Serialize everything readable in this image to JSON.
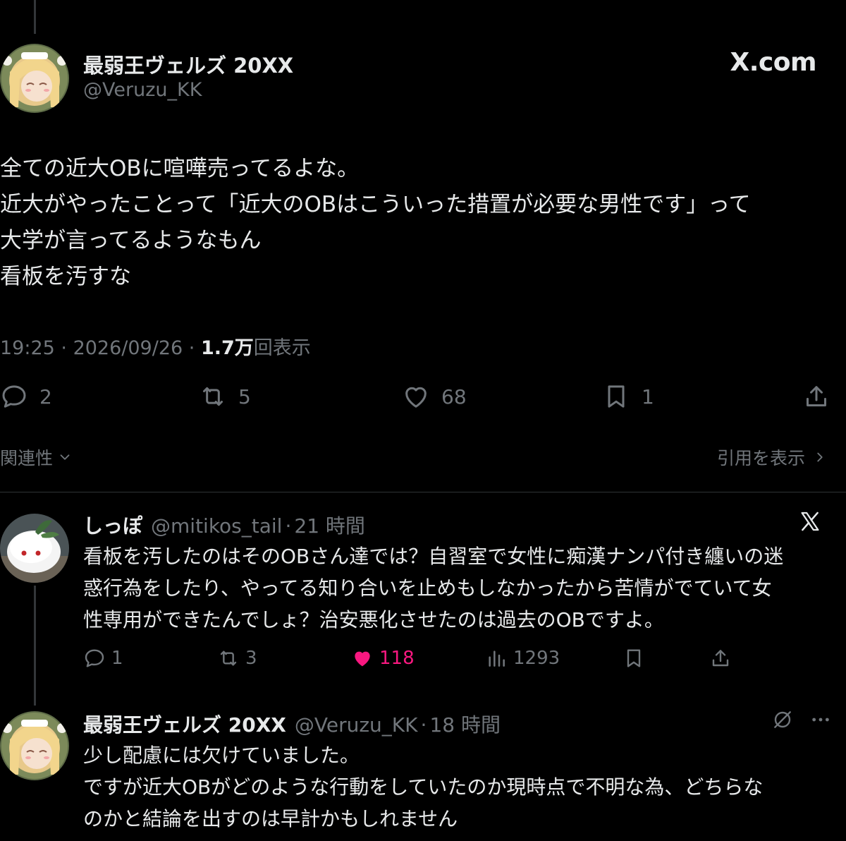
{
  "site_label": "X.com",
  "main_tweet": {
    "display_name": "最弱王ヴェルズ 20XX",
    "handle": "@Veruzu_KK",
    "body_lines": [
      "全ての近大OBに喧嘩売ってるよな。",
      "近大がやったことって「近大のOBはこういった措置が必要な男性です」って",
      "大学が言ってるようなもん",
      "看板を汚すな"
    ],
    "time": "19:25",
    "date": "2026/09/26",
    "views_count": "1.7万",
    "views_label": "回表示",
    "replies": "2",
    "reposts": "5",
    "likes": "68",
    "bookmarks": "1"
  },
  "sort_label": "関連性",
  "quotes_label": "引用を表示",
  "replies": [
    {
      "display_name": "しっぽ",
      "handle": "@mitikos_tail",
      "time": "21 時間",
      "body_lines": [
        "看板を汚したのはそのOBさん達では？自習室で女性に痴漢ナンパ付き纏いの迷",
        "惑行為をしたり、やってる知り合いを止めもしなかったから苦情がでていて女",
        "性専用ができたんでしょ？治安悪化させたのは過去のOBですよ。"
      ],
      "replies": "1",
      "reposts": "3",
      "likes": "118",
      "views": "1293"
    },
    {
      "display_name": "最弱王ヴェルズ 20XX",
      "handle": "@Veruzu_KK",
      "time": "18 時間",
      "body_lines": [
        "少し配慮には欠けていました。",
        "ですが近大OBがどのような行動をしていたのか現時点で不明な為、どちらな",
        "のかと結論を出すのは早計かもしれません"
      ]
    }
  ],
  "colors": {
    "background": "#000000",
    "text": "#e7e9ea",
    "muted": "#71767b",
    "like_active": "#f91880"
  }
}
